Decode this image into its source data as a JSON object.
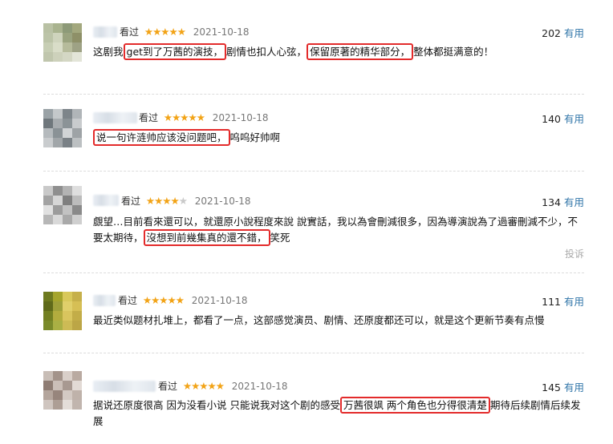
{
  "colors": {
    "accent_link": "#3377aa",
    "star": "#f2a316",
    "highlight_box": "#e32b2b"
  },
  "reviews": [
    {
      "seen": "看过",
      "stars": 5,
      "date": "2021-10-18",
      "votes": "202",
      "useful": "有用",
      "segments": [
        {
          "t": "这剧我"
        },
        {
          "t": "get到了万茜的演技，",
          "hl": true
        },
        {
          "t": "剧情也扣人心弦，"
        },
        {
          "t": "保留原著的精华部分，",
          "hl": true
        },
        {
          "t": "整体都挺满意的！"
        }
      ]
    },
    {
      "seen": "看过",
      "stars": 5,
      "date": "2021-10-18",
      "votes": "140",
      "useful": "有用",
      "segments": [
        {
          "t": "说一句许涟帅应该没问题吧，",
          "hl": true
        },
        {
          "t": "呜呜好帅啊"
        }
      ]
    },
    {
      "seen": "看过",
      "stars": 4,
      "date": "2021-10-18",
      "votes": "134",
      "useful": "有用",
      "segments": [
        {
          "t": "覷望…目前看來還可以，就還原小說程度來說 說實話，我以為會刪減很多，因為導演說為了過審刪減不少，不要太期待，"
        },
        {
          "t": "沒想到前幾集真的還不錯，",
          "hl": true
        },
        {
          "t": "笑死"
        }
      ],
      "report": "投诉"
    },
    {
      "seen": "看过",
      "stars": 5,
      "date": "2021-10-18",
      "votes": "111",
      "useful": "有用",
      "segments": [
        {
          "t": "最近类似题材扎堆上，都看了一点，这部感觉演员、剧情、还原度都还可以，就是这个更新节奏有点慢"
        }
      ]
    },
    {
      "seen": "看过",
      "stars": 5,
      "date": "2021-10-18",
      "votes": "145",
      "useful": "有用",
      "segments": [
        {
          "t": "据说还原度很高 因为没看小说 只能说我对这个剧的感受"
        },
        {
          "t": "万茜很飒 两个角色也分得很清楚",
          "hl": true
        },
        {
          "t": "期待后续剧情后续发展"
        }
      ]
    }
  ]
}
